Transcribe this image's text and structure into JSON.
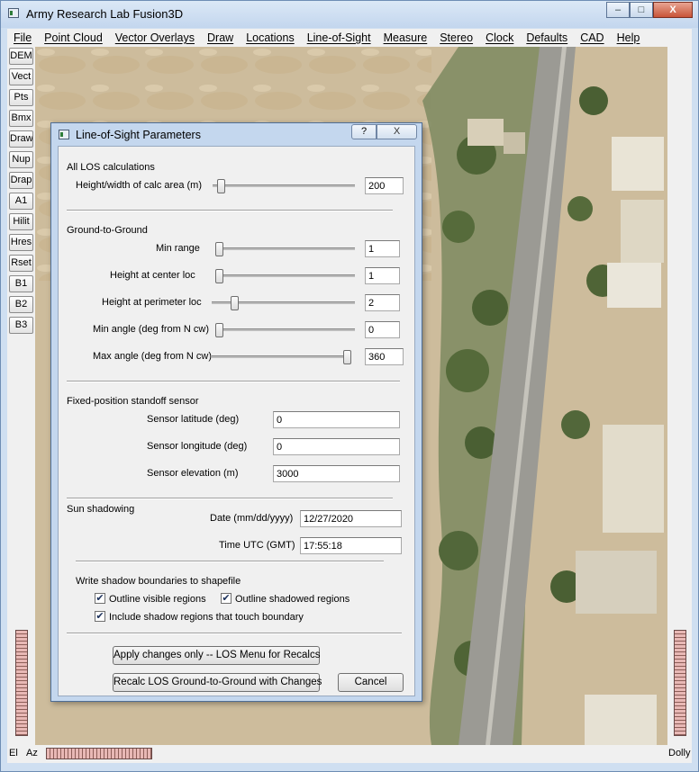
{
  "window": {
    "title": "Army Research Lab Fusion3D",
    "caption": {
      "minimize": "–",
      "maximize": "□",
      "close": "X"
    }
  },
  "menubar": [
    "File",
    "Point Cloud",
    "Vector Overlays",
    "Draw",
    "Locations",
    "Line-of-Sight",
    "Measure",
    "Stereo",
    "Clock",
    "Defaults",
    "CAD",
    "Help"
  ],
  "toolbar": [
    "DEM",
    "Vect",
    "Pts",
    "Bmx",
    "Draw",
    "Nup",
    "Drap",
    "A1",
    "Hilit",
    "Hres",
    "Rset",
    "B1",
    "B2",
    "B3"
  ],
  "bottom_bar": {
    "el_label": "El",
    "az_label": "Az",
    "dolly_label": "Dolly"
  },
  "dialog": {
    "title": "Line-of-Sight Parameters",
    "help_label": "?",
    "close_label": "X",
    "all_los": {
      "heading": "All LOS calculations",
      "calc_area": {
        "label": "Height/width of calc area (m)",
        "value": "200",
        "slider_fraction": 0.03
      }
    },
    "ground_to_ground": {
      "heading": "Ground-to-Ground",
      "min_range": {
        "label": "Min range",
        "value": "1",
        "slider_fraction": 0.0
      },
      "height_center": {
        "label": "Height at center loc",
        "value": "1",
        "slider_fraction": 0.0
      },
      "height_perimeter": {
        "label": "Height at perimeter loc",
        "value": "2",
        "slider_fraction": 0.14
      },
      "min_angle": {
        "label": "Min angle (deg from N cw)",
        "value": "0",
        "slider_fraction": 0.0
      },
      "max_angle": {
        "label": "Max angle (deg from N cw)",
        "value": "360",
        "slider_fraction": 1.0
      }
    },
    "standoff": {
      "heading": "Fixed-position standoff sensor",
      "latitude": {
        "label": "Sensor latitude (deg)",
        "value": "0"
      },
      "longitude": {
        "label": "Sensor longitude (deg)",
        "value": "0"
      },
      "elevation": {
        "label": "Sensor elevation (m)",
        "value": "3000"
      }
    },
    "sun": {
      "heading": "Sun shadowing",
      "date": {
        "label": "Date (mm/dd/yyyy)",
        "value": "12/27/2020"
      },
      "time": {
        "label": "Time UTC (GMT)",
        "value": "17:55:18"
      }
    },
    "shapefile": {
      "heading": "Write shadow boundaries to shapefile",
      "outline_visible": {
        "label": "Outline visible regions",
        "checked": true
      },
      "outline_shadowed": {
        "label": "Outline shadowed regions",
        "checked": true
      },
      "include_boundary": {
        "label": "Include shadow regions that touch boundary",
        "checked": true
      }
    },
    "buttons": {
      "apply": "Apply changes only -- LOS Menu for Recalcs",
      "recalc": "Recalc LOS Ground-to-Ground with Changes",
      "cancel": "Cancel"
    }
  }
}
